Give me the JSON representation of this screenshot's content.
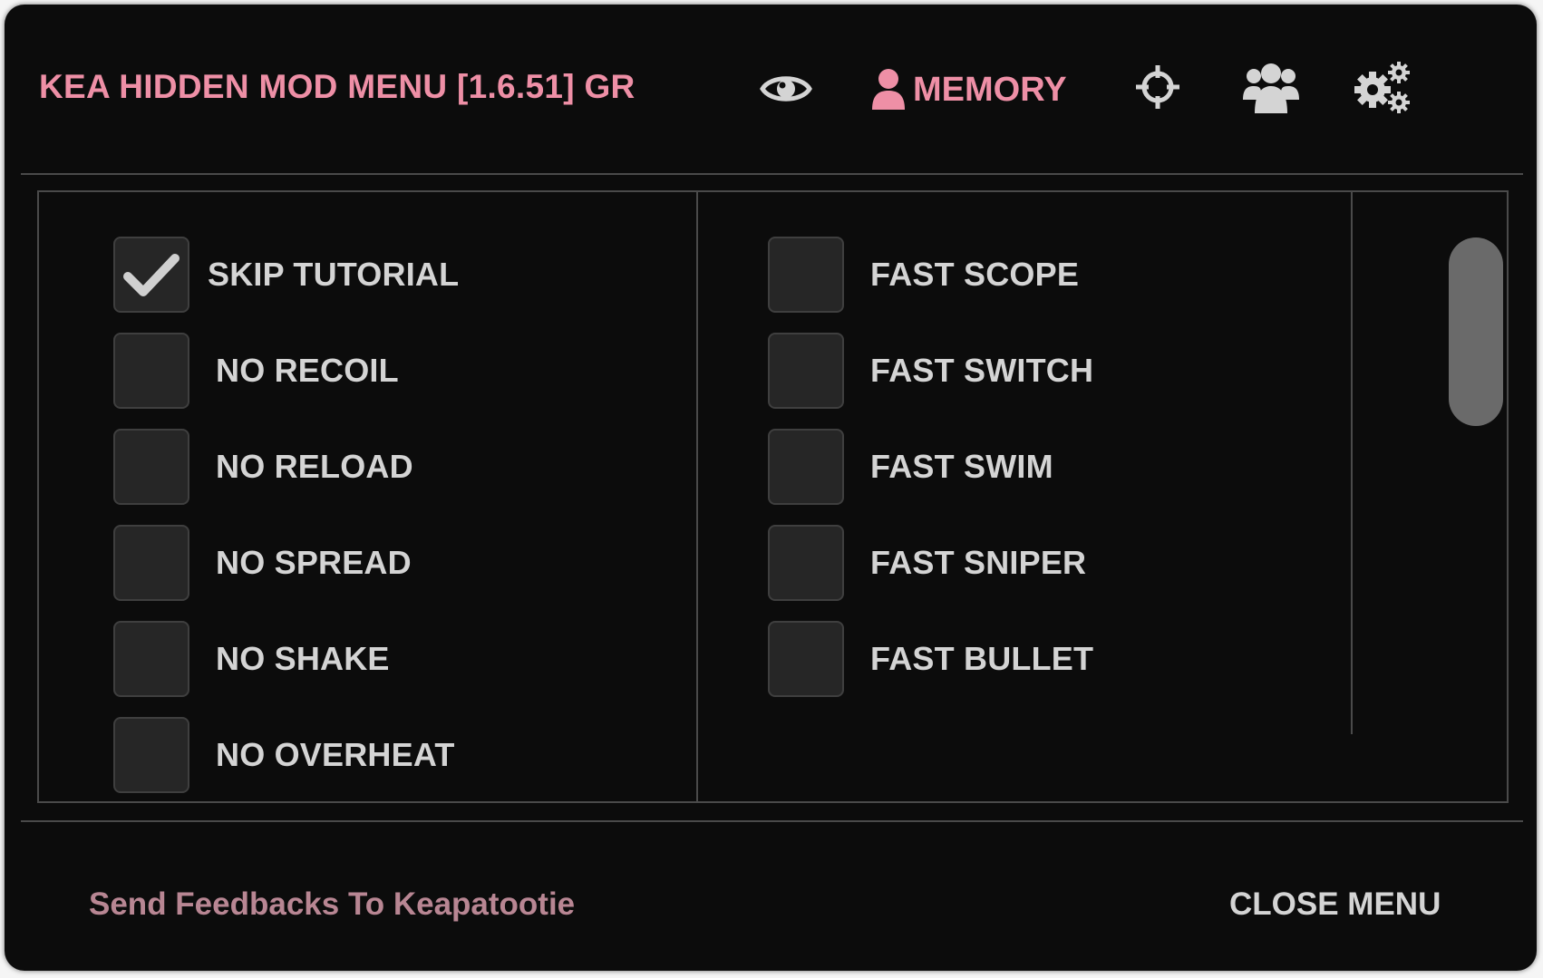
{
  "header": {
    "title": "KEA HIDDEN MOD MENU [1.6.51] GR",
    "tabs": [
      {
        "icon": "eye-icon",
        "label": ""
      },
      {
        "icon": "user-icon",
        "label": "MEMORY",
        "active": true
      },
      {
        "icon": "crosshair-icon",
        "label": ""
      },
      {
        "icon": "users-icon",
        "label": ""
      },
      {
        "icon": "gears-icon",
        "label": ""
      }
    ]
  },
  "options": {
    "left": [
      {
        "label": "SKIP TUTORIAL",
        "checked": true
      },
      {
        "label": "NO RECOIL",
        "checked": false
      },
      {
        "label": "NO RELOAD",
        "checked": false
      },
      {
        "label": "NO SPREAD",
        "checked": false
      },
      {
        "label": "NO SHAKE",
        "checked": false
      },
      {
        "label": "NO OVERHEAT",
        "checked": false
      }
    ],
    "right": [
      {
        "label": "FAST SCOPE",
        "checked": false
      },
      {
        "label": "FAST SWITCH",
        "checked": false
      },
      {
        "label": "FAST SWIM",
        "checked": false
      },
      {
        "label": "FAST SNIPER",
        "checked": false
      },
      {
        "label": "FAST BULLET",
        "checked": false
      }
    ]
  },
  "footer": {
    "feedback": "Send Feedbacks To Keapatootie",
    "close": "CLOSE MENU"
  },
  "colors": {
    "accent": "#ee8fa6",
    "feedback": "#b88693",
    "background": "#0c0c0c",
    "checkbox": "#262626",
    "text": "#d4d4d4"
  }
}
